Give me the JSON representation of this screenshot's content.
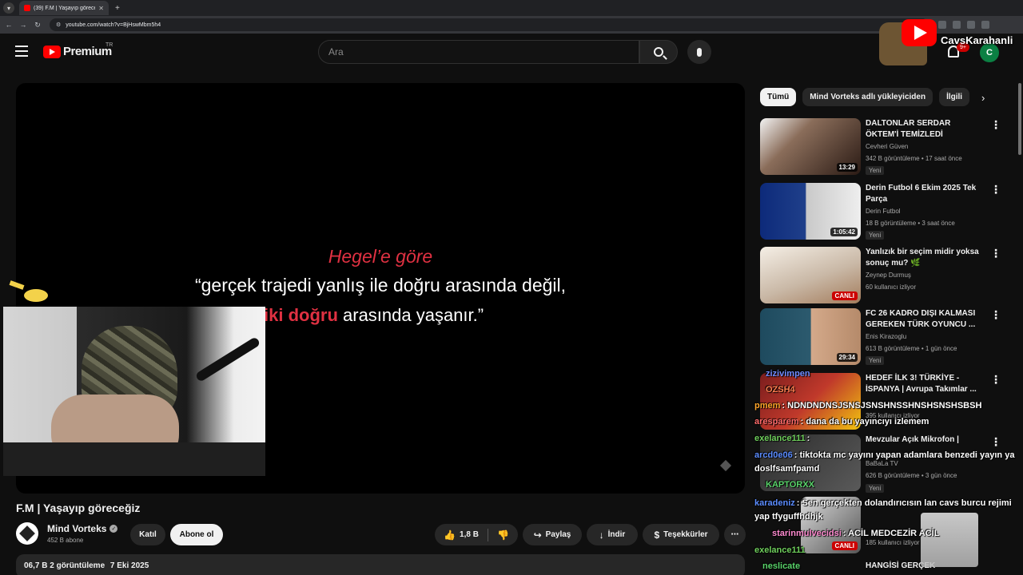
{
  "browser": {
    "tab_title": "(39) F.M | Yaşayıp göreceğiz - Yo",
    "url": "youtube.com/watch?v=BjHswMbm5h4"
  },
  "header": {
    "logo_text": "Premium",
    "logo_region": "TR",
    "search_placeholder": "Ara",
    "notif_count": "9+",
    "user_initial": "C"
  },
  "overlay": {
    "streamer_name": "CavsKarahanli"
  },
  "video": {
    "quote_line1": "Hegel’e göre",
    "quote_line2": "“gerçek trajedi yanlış ile doğru arasında değil,",
    "quote_line3_emph": "iki doğru",
    "quote_line3_rest": " arasında yaşanır.”",
    "title": "F.M | Yaşayıp göreceğiz",
    "channel": "Mind Vorteks",
    "subscribers": "452 B abone",
    "join_label": "Katıl",
    "subscribe_label": "Abone ol",
    "likes": "1,8 B",
    "share_label": "Paylaş",
    "download_label": "İndir",
    "thanks_label": "Teşekkürler",
    "desc_views": "06,7 Β 2 görüntüleme",
    "desc_date": "7 Eki 2025"
  },
  "sidebar": {
    "chips": [
      "Tümü",
      "Mind Vorteks adlı yükleyiciden",
      "İlgili"
    ],
    "recs": [
      {
        "title": "DALTONLAR SERDAR ÖKTEM'İ TEMİZLEDİ",
        "channel": "Cevheri Güven",
        "meta": "342 B görüntüleme • 17 saat önce",
        "badge": "Yeni",
        "duration": "13:29",
        "color": "#8a6d5a"
      },
      {
        "title": "Derin Futbol 6 Ekim 2025 Tek Parça",
        "channel": "Derin Futbol",
        "meta": "18 B görüntüleme • 3 saat önce",
        "badge": "Yeni",
        "duration": "1:05:42",
        "color": "#1f3f8a"
      },
      {
        "title": "Yanlızık bir seçim midir yoksa sonuç mu? 🌿",
        "channel": "Zeynep Durmuş",
        "meta": "60 kullanıcı izliyor",
        "badge": "",
        "duration": "CANLI",
        "color": "#c9b8a6"
      },
      {
        "title": "FC 26 KADRO DIŞI KALMASI GEREKEN TÜRK OYUNCU ...",
        "channel": "Enis Kirazoglu",
        "meta": "613 B görüntüleme • 1 gün önce",
        "badge": "Yeni",
        "duration": "29:34",
        "color": "#2c5a6e"
      },
      {
        "title": "HEDEF İLK 3! TÜRKİYE - İSPANYA | Avrupa Takımlar ...",
        "channel": "",
        "meta": "395 kullanıcı izliyor",
        "badge": "",
        "duration": "",
        "color": "#7a1d1d"
      }
    ]
  },
  "chat": [
    {
      "user": "zizivimpen",
      "msg": "",
      "color": "#6f8cff"
    },
    {
      "user": "OZSH4",
      "msg": "",
      "color": "#ff7f50"
    },
    {
      "user": "pmem",
      "msg": ": NDNDNDNSJSNSJSNSHNSSHNSHSNSHSBSH",
      "color": "#ffa62b"
    },
    {
      "user": "aresparem",
      "msg": ": dana da bu yayıncıyı izlemem",
      "color": "#ff6b6b"
    },
    {
      "user": "exelance111",
      "msg": ":",
      "color": "#6fcf5c"
    },
    {
      "user": "arcd0e06",
      "msg": ": tiktokta mc yayını yapan adamlara benzedi yayın ya doslfsamfpamd",
      "color": "#5b8cff"
    },
    {
      "user": "KAPTORXX",
      "msg": "",
      "color": "#59d36a"
    },
    {
      "user": "karadeniz",
      "msg": ": Sen gerçekten dolandırıcısın lan cavs burcu rejimi yap tfyguffhdhjk",
      "color": "#5b8cff"
    },
    {
      "user": "starinmulvecidsi",
      "msg": ": ACİL MEDCEZİR ACİL",
      "color": "#ff8bd0"
    },
    {
      "user": "exelance111",
      "msg": "",
      "color": "#6fcf5c"
    },
    {
      "user": "neslicate",
      "msg": "",
      "color": "#59d36a"
    }
  ]
}
